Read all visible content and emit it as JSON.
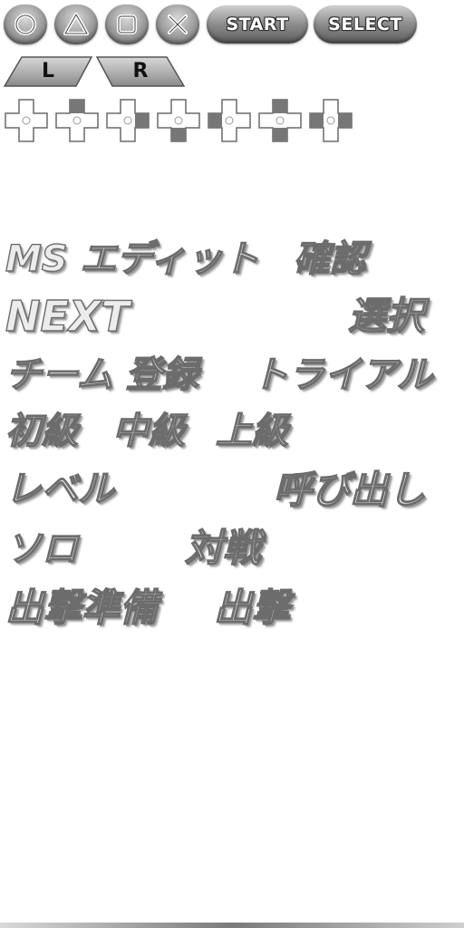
{
  "face_buttons": [
    {
      "name": "circle",
      "icon": "circle-icon"
    },
    {
      "name": "triangle",
      "icon": "triangle-icon"
    },
    {
      "name": "square",
      "icon": "square-icon"
    },
    {
      "name": "cross",
      "icon": "cross-icon"
    }
  ],
  "system_buttons": {
    "start_label": "START",
    "select_label": "SELECT"
  },
  "shoulder_buttons": {
    "l_label": "L",
    "r_label": "R"
  },
  "dpad_directions": [
    "none",
    "up",
    "right",
    "down",
    "left",
    "up-down",
    "left-right"
  ],
  "labels": {
    "ms_edit": "MS エディット",
    "confirm": "確認",
    "next": "NEXT",
    "select": "選択",
    "team_register": "チーム 登録",
    "trial": "トライアル",
    "beginner": "初級",
    "intermediate": "中級",
    "advanced": "上級",
    "level": "レベル",
    "call": "呼び出し",
    "solo": "ソロ",
    "versus": "対戦",
    "sortie_prep": "出撃準備",
    "sortie": "出撃"
  },
  "colors": {
    "button_gray": "#8c8c8c",
    "text_fill": "#ececec",
    "text_outline": "#6c6c6c"
  }
}
